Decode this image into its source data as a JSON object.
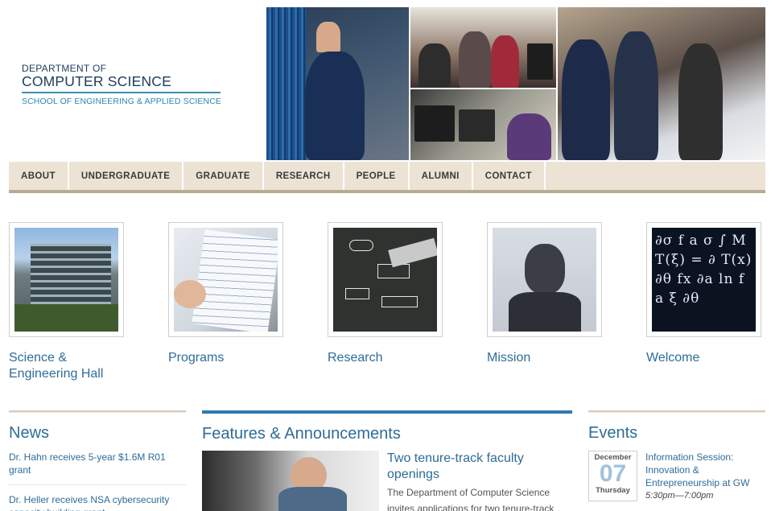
{
  "logo": {
    "dept_line": "DEPARTMENT OF",
    "name_line": "COMPUTER SCIENCE",
    "school_line": "SCHOOL OF ENGINEERING & APPLIED SCIENCE"
  },
  "nav": {
    "items": [
      {
        "label": "ABOUT"
      },
      {
        "label": "UNDERGRADUATE"
      },
      {
        "label": "GRADUATE"
      },
      {
        "label": "RESEARCH"
      },
      {
        "label": "PEOPLE"
      },
      {
        "label": "ALUMNI"
      },
      {
        "label": "CONTACT"
      }
    ]
  },
  "tiles": [
    {
      "label": "Science & Engineering Hall"
    },
    {
      "label": "Programs"
    },
    {
      "label": "Research"
    },
    {
      "label": "Mission"
    },
    {
      "label": "Welcome"
    }
  ],
  "news": {
    "heading": "News",
    "items": [
      {
        "text": "Dr. Hahn receives 5-year $1.6M R01 grant"
      },
      {
        "text": "Dr. Heller receives NSA cybersecurity capacity building grant"
      }
    ]
  },
  "features": {
    "heading": "Features & Announcements",
    "title": "Two tenure-track faculty openings",
    "desc": "The Department of Computer Science invites applications for two tenure-track"
  },
  "events": {
    "heading": "Events",
    "month": "December",
    "day": "07",
    "weekday": "Thursday",
    "title": "Information Session: Innovation & Entrepreneurship at GW",
    "time": "5:30pm—7:00pm"
  },
  "colors": {
    "link": "#2f6c98",
    "nav_bg": "#ece3d5",
    "accent": "#2f7bae"
  }
}
